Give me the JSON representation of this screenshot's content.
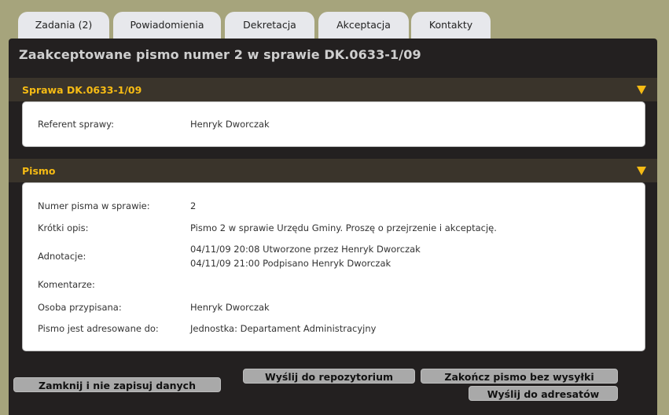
{
  "tabs": [
    {
      "label": "Zadania (2)"
    },
    {
      "label": "Powiadomienia"
    },
    {
      "label": "Dekretacja"
    },
    {
      "label": "Akceptacja"
    },
    {
      "label": "Kontakty"
    }
  ],
  "panel": {
    "title": "Zaakceptowane pismo numer 2 w sprawie DK.0633-1/09"
  },
  "sprawa": {
    "title": "Sprawa DK.0633-1/09",
    "referent_label": "Referent sprawy:",
    "referent_value": "Henryk Dworczak"
  },
  "pismo": {
    "title": "Pismo",
    "numer_label": "Numer pisma w sprawie:",
    "numer_value": "2",
    "opis_label": "Krótki opis:",
    "opis_value": "Pismo 2 w sprawie Urzędu Gminy. Proszę o przejrzenie i akceptację.",
    "adnotacje_label": "Adnotacje:",
    "adnotacje_lines": [
      "04/11/09 20:08 Utworzone przez Henryk Dworczak",
      "04/11/09 21:00 Podpisano Henryk Dworczak"
    ],
    "komentarze_label": "Komentarze:",
    "osoba_label": "Osoba przypisana:",
    "osoba_value": "Henryk Dworczak",
    "adresowane_label": "Pismo jest adresowane do:",
    "adresowane_value": "Jednostka: Departament Administracyjny"
  },
  "buttons": {
    "zamknij": "Zamknij i nie zapisuj danych",
    "repozytorium": "Wyślij do repozytorium",
    "zakoncz": "Zakończ pismo bez wysyłki",
    "adresatow": "Wyślij do adresatów"
  },
  "colors": {
    "background": "#a6a47c",
    "panel": "#232020",
    "section_bar": "#3a342b",
    "accent": "#f6bb14",
    "button": "#a9a9a9"
  }
}
